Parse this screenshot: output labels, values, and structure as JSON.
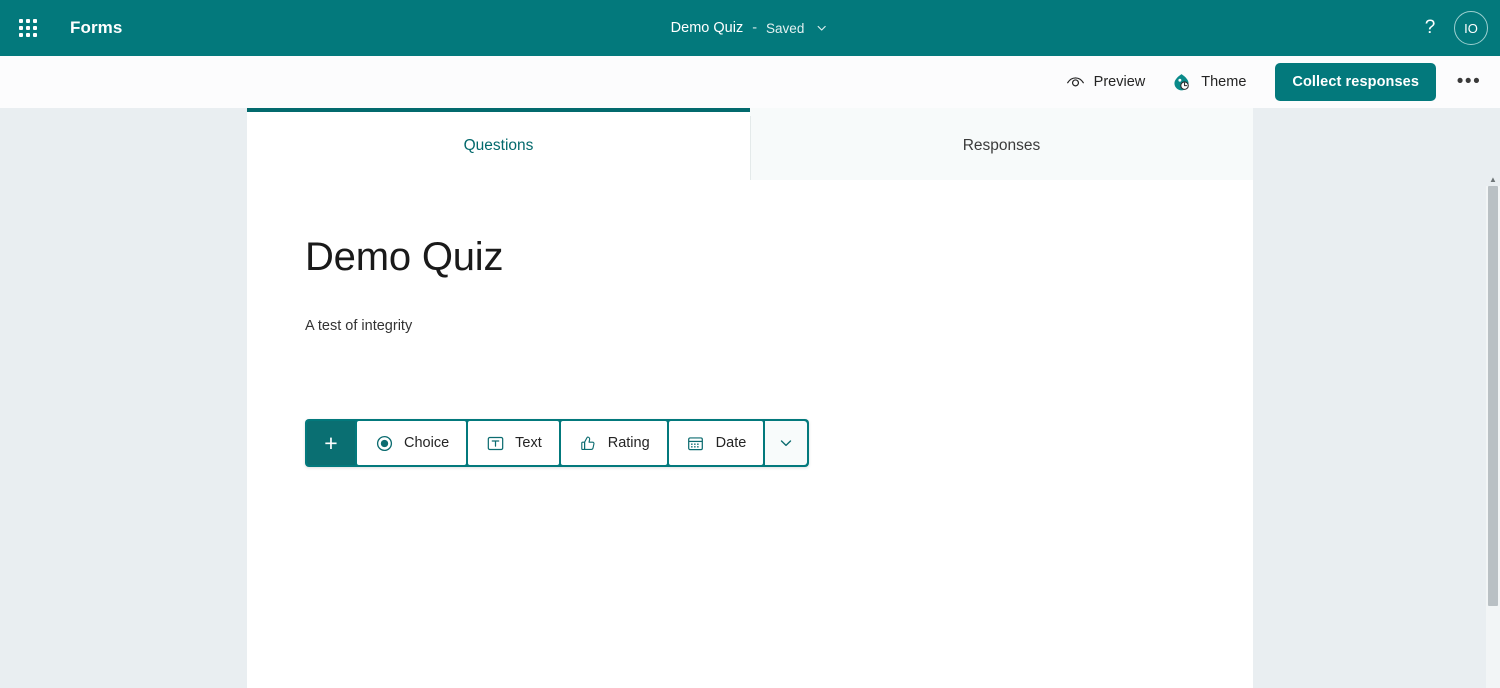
{
  "header": {
    "waffle_icon": "app-launcher-waffle-icon",
    "brand": "Forms",
    "doc_title": "Demo Quiz",
    "separator": "-",
    "save_status": "Saved",
    "chevron_icon": "chevron-down-icon",
    "help_label": "?",
    "help_icon": "help-question-icon",
    "avatar_initials": "IO"
  },
  "toolbar": {
    "preview_label": "Preview",
    "preview_icon": "eye-icon",
    "theme_label": "Theme",
    "theme_icon": "theme-palette-icon",
    "collect_label": "Collect responses",
    "more_label": "•••",
    "more_icon": "more-horizontal-icon"
  },
  "tabs": [
    {
      "label": "Questions",
      "active": true
    },
    {
      "label": "Responses",
      "active": false
    }
  ],
  "form": {
    "title": "Demo Quiz",
    "description": "A test of integrity"
  },
  "add_question_bar": {
    "plus_label": "+",
    "plus_icon": "plus-icon",
    "expand_icon": "chevron-down-icon",
    "types": [
      {
        "label": "Choice",
        "icon": "radio-button-icon"
      },
      {
        "label": "Text",
        "icon": "text-box-icon"
      },
      {
        "label": "Rating",
        "icon": "thumbs-up-icon"
      },
      {
        "label": "Date",
        "icon": "calendar-icon"
      }
    ]
  },
  "colors": {
    "brand_teal": "#03797c",
    "tab_active_teal": "#036a6d",
    "page_background": "#e9eef1",
    "card_background": "#ffffff",
    "toolbar_background": "#fcfcfd",
    "scrollbar_thumb": "#b9c0c4"
  },
  "scrollbar": {
    "up_arrow_icon": "scroll-up-arrow-icon"
  }
}
